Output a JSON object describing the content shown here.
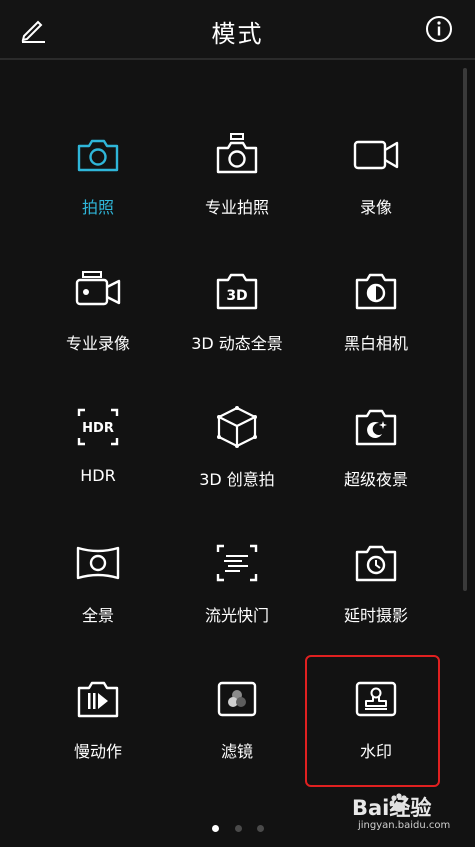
{
  "header": {
    "title": "模式",
    "edit_icon": "pencil-icon",
    "info_icon": "info-icon"
  },
  "modes": [
    {
      "label": "拍照",
      "icon": "camera-icon",
      "active": true
    },
    {
      "label": "专业拍照",
      "icon": "pro-camera-icon",
      "active": false
    },
    {
      "label": "录像",
      "icon": "video-icon",
      "active": false
    },
    {
      "label": "专业录像",
      "icon": "pro-video-icon",
      "active": false
    },
    {
      "label": "3D 动态全景",
      "icon": "3d-panorama-icon",
      "active": false
    },
    {
      "label": "黑白相机",
      "icon": "monochrome-icon",
      "active": false
    },
    {
      "label": "HDR",
      "icon": "hdr-icon",
      "active": false
    },
    {
      "label": "3D 创意拍",
      "icon": "cube-icon",
      "active": false
    },
    {
      "label": "超级夜景",
      "icon": "night-icon",
      "active": false
    },
    {
      "label": "全景",
      "icon": "panorama-icon",
      "active": false
    },
    {
      "label": "流光快门",
      "icon": "light-painting-icon",
      "active": false
    },
    {
      "label": "延时摄影",
      "icon": "timelapse-icon",
      "active": false
    },
    {
      "label": "慢动作",
      "icon": "slow-motion-icon",
      "active": false
    },
    {
      "label": "滤镜",
      "icon": "filter-icon",
      "active": false
    },
    {
      "label": "水印",
      "icon": "watermark-stamp-icon",
      "active": false
    }
  ],
  "pagination": {
    "pages": 3,
    "current": 1
  },
  "watermark": {
    "brand": "Bai经验",
    "url": "jingyan.baidu.com"
  },
  "colors": {
    "accent": "#2fb6d9",
    "background": "#121212",
    "highlight_box": "#e02020"
  }
}
